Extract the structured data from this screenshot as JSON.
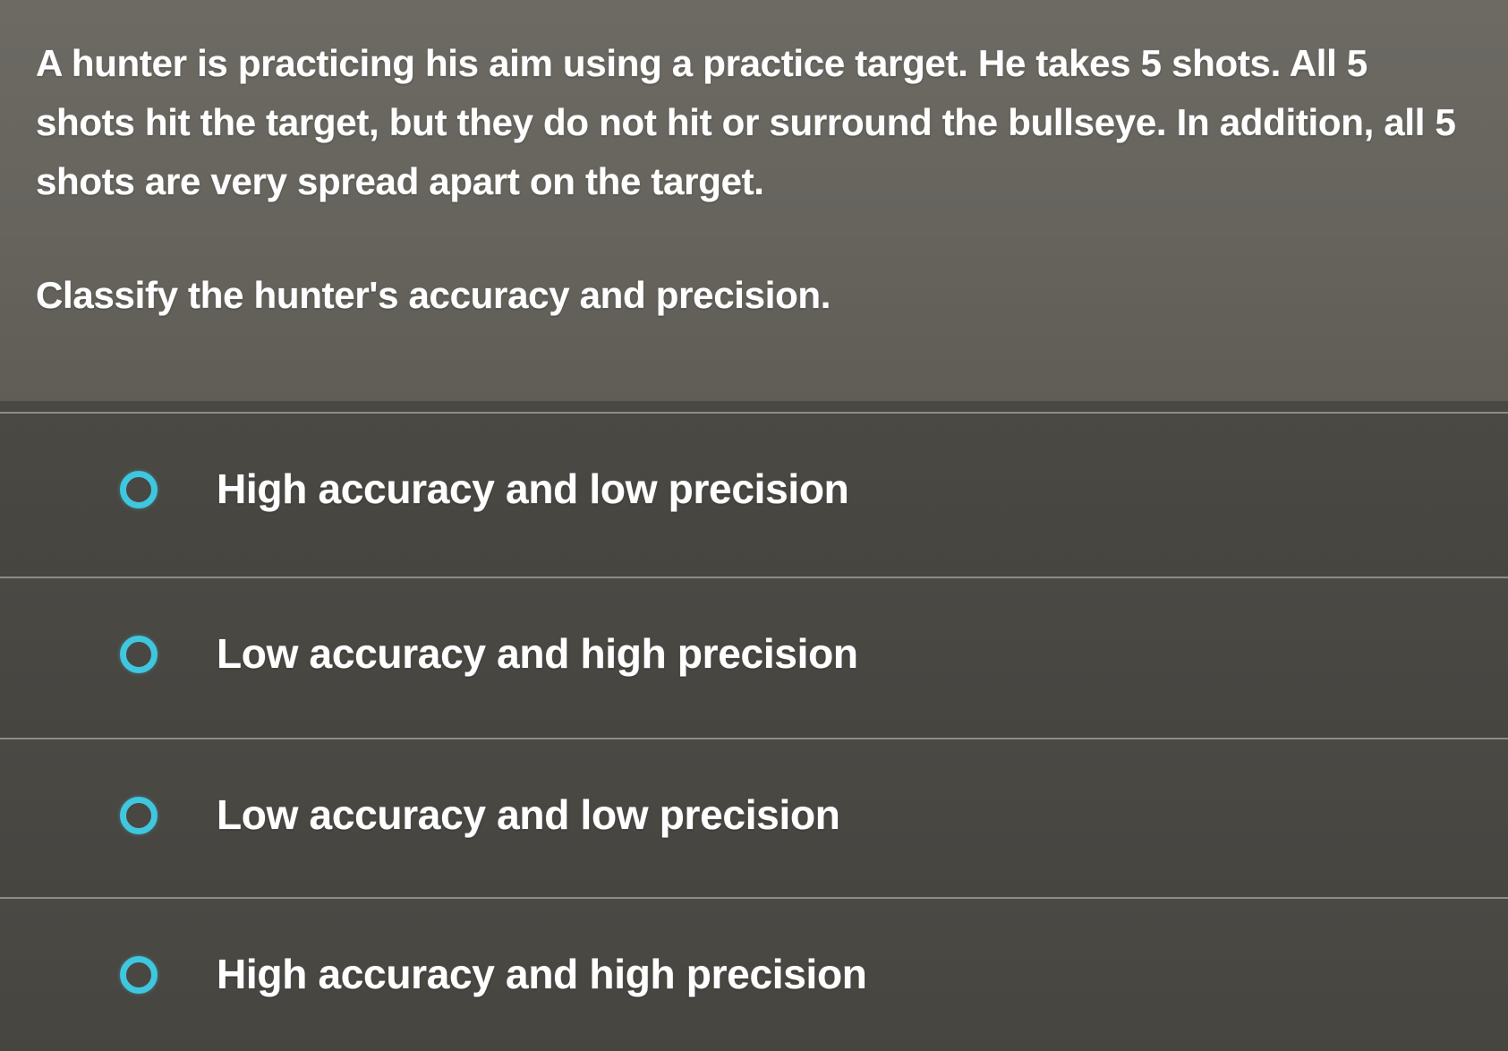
{
  "question": {
    "text": "A hunter is practicing his aim using a practice target. He takes 5 shots. All 5 shots hit the target, but they do not hit or surround the bullseye. In addition, all 5 shots are very spread apart on the target.",
    "prompt": "Classify the hunter's accuracy and precision."
  },
  "options": [
    {
      "label": "High accuracy and low precision",
      "selected": false
    },
    {
      "label": "Low accuracy and high precision",
      "selected": false
    },
    {
      "label": "Low accuracy and low precision",
      "selected": false
    },
    {
      "label": "High accuracy and high precision",
      "selected": false
    }
  ],
  "colors": {
    "radio_accent": "#3fc7df",
    "text": "#ffffff",
    "question_bg": "#66645d",
    "options_bg": "#474540",
    "divider": "#8e8c86"
  }
}
